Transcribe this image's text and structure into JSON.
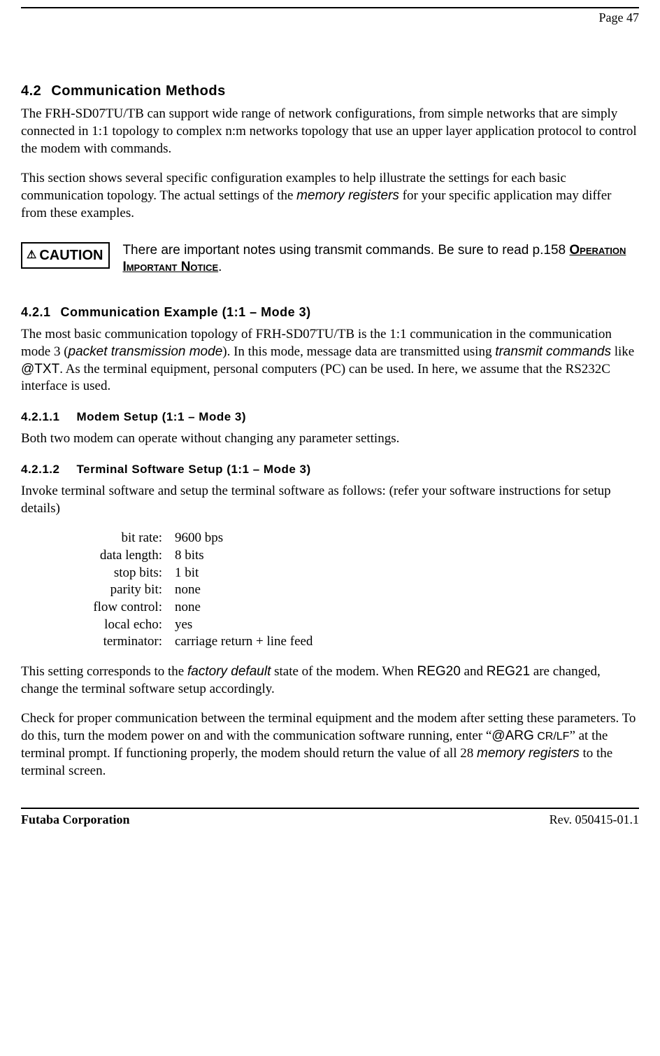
{
  "header": {
    "page_label": "Page  47"
  },
  "section_4_2": {
    "number": "4.2",
    "title": "Communication Methods",
    "p1_a": "The FRH-SD07TU/TB can support wide range of network configurations, from simple networks that are simply connected in 1:1 topology to complex n:m networks topology that use an upper layer application protocol to control the modem with commands.",
    "p2_a": "This section shows several specific configuration examples to help illustrate the settings for each basic communication topology. The actual settings of the ",
    "p2_mem": "memory registers",
    "p2_b": " for your specific application may differ from these examples."
  },
  "caution": {
    "label": "CAUTION",
    "text_a": "There are important notes using transmit commands. Be sure to read p.158 ",
    "notice": "Operation Important Notice",
    "text_b": "."
  },
  "section_4_2_1": {
    "number": "4.2.1",
    "title": "Communication Example (1:1 – Mode 3)",
    "p1_a": "The most basic communication topology of FRH-SD07TU/TB is the 1:1 communication in the communication mode 3 (",
    "p1_ptm": "packet transmission mode",
    "p1_b": "). In this mode, message data are transmitted using ",
    "p1_tc": "transmit commands",
    "p1_c": " like ",
    "p1_txt": "@TXT",
    "p1_d": ". As the terminal equipment, personal computers (PC) can be used. In here, we assume that the RS232C interface is used."
  },
  "section_4_2_1_1": {
    "number": "4.2.1.1",
    "title": "Modem Setup (1:1 – Mode 3)",
    "p1": "Both two modem can operate without changing any parameter settings."
  },
  "section_4_2_1_2": {
    "number": "4.2.1.2",
    "title": "Terminal Software Setup (1:1 – Mode 3)",
    "p1": "Invoke terminal software and setup the terminal software as follows: (refer your software instructions for setup details)",
    "settings": [
      {
        "label": "bit rate:",
        "value": "9600 bps"
      },
      {
        "label": "data length:",
        "value": "8 bits"
      },
      {
        "label": "stop bits:",
        "value": "1 bit"
      },
      {
        "label": "parity bit:",
        "value": "none"
      },
      {
        "label": "flow control:",
        "value": "none"
      },
      {
        "label": "local echo:",
        "value": "yes"
      },
      {
        "label": "terminator:",
        "value": "carriage return + line feed"
      }
    ],
    "p2_a": "This setting corresponds to the ",
    "p2_fd": "factory default",
    "p2_b": " state of the modem. When ",
    "p2_reg20": "REG20",
    "p2_c": " and ",
    "p2_reg21": "REG21",
    "p2_d": " are changed, change the terminal software setup accordingly.",
    "p3_a": "Check for proper communication between the terminal equipment and the modem after setting these parameters. To do this, turn the modem power on and with the communication software running, enter “",
    "p3_arg": "@ARG",
    "p3_crlf": " CR/LF",
    "p3_b": "” at the terminal prompt. If functioning properly, the modem should return the value of all 28 ",
    "p3_mem": "memory registers",
    "p3_c": " to the terminal screen."
  },
  "footer": {
    "left": "Futaba Corporation",
    "right": "Rev. 050415-01.1"
  }
}
